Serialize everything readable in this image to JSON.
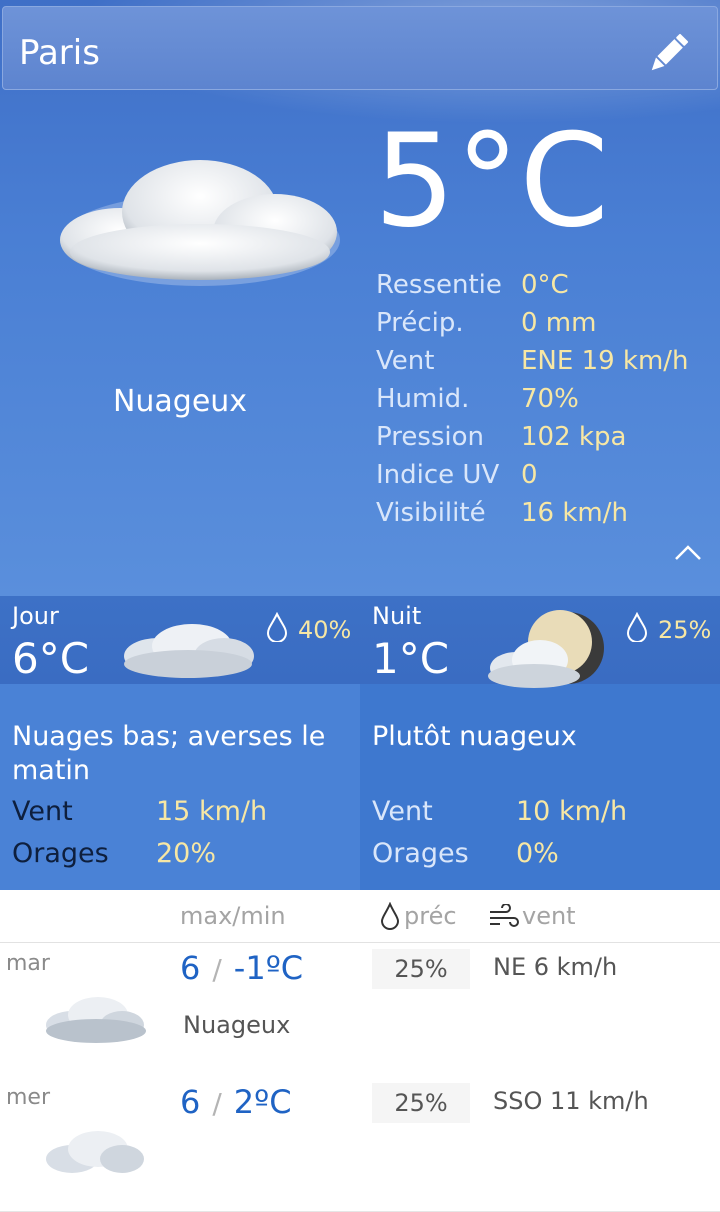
{
  "header": {
    "city": "Paris"
  },
  "current": {
    "temperature": "5°C",
    "condition": "Nuageux",
    "details": [
      {
        "label": "Ressentie",
        "value": "0°C"
      },
      {
        "label": "Précip.",
        "value": "0 mm"
      },
      {
        "label": "Vent",
        "value": "ENE 19 km/h"
      },
      {
        "label": "Humid.",
        "value": "70%"
      },
      {
        "label": "Pression",
        "value": "102 kpa"
      },
      {
        "label": "Indice UV",
        "value": "0"
      },
      {
        "label": "Visibilité",
        "value": "16 km/h"
      }
    ]
  },
  "day": {
    "label": "Jour",
    "temp": "6°C",
    "precip": "40%",
    "description": "Nuages bas; averses le matin",
    "wind_label": "Vent",
    "wind": "15 km/h",
    "storm_label": "Orages",
    "storm": "20%"
  },
  "night": {
    "label": "Nuit",
    "temp": "1°C",
    "precip": "25%",
    "description": "Plutôt nuageux",
    "wind_label": "Vent",
    "wind": "10 km/h",
    "storm_label": "Orages",
    "storm": "0%"
  },
  "forecast": {
    "headers": {
      "maxmin": "max/min",
      "precip": "préc",
      "wind": "vent"
    },
    "rows": [
      {
        "day": "mar",
        "max": "6",
        "min": "-1ºC",
        "condition": "Nuageux",
        "precip": "25%",
        "wind": "NE 6 km/h"
      },
      {
        "day": "mer",
        "max": "6",
        "min": "2ºC",
        "condition": "",
        "precip": "25%",
        "wind": "SSO 11 km/h"
      }
    ]
  },
  "colors": {
    "sky": "#4a7fd4",
    "value_yellow": "#f7e7a4",
    "forecast_blue": "#1f63c4"
  },
  "icons": [
    "pencil-icon",
    "cloud-icon",
    "chevron-up-icon",
    "drop-icon",
    "moon-cloud-icon",
    "wind-icon"
  ]
}
